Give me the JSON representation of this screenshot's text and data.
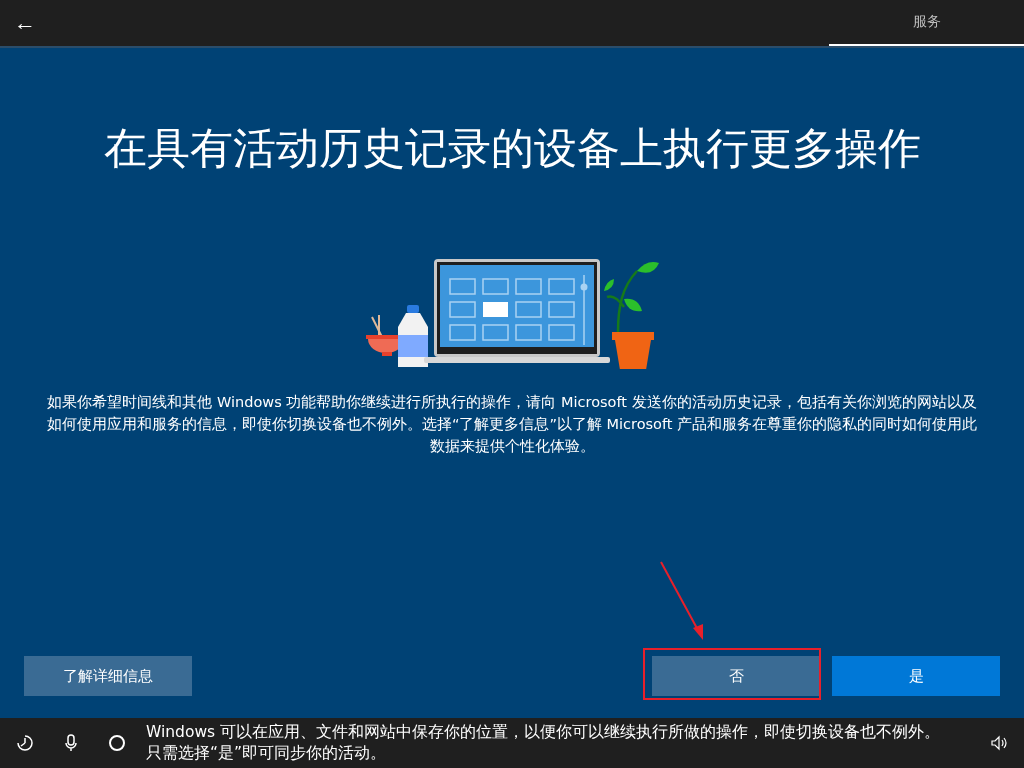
{
  "top_bar": {
    "back": "←",
    "tabs": [
      {
        "label": "服务",
        "selected": true
      }
    ]
  },
  "title": "在具有活动历史记录的设备上执行更多操作",
  "description": "如果你希望时间线和其他 Windows 功能帮助你继续进行所执行的操作，请向 Microsoft 发送你的活动历史记录，包括有关你浏览的网站以及如何使用应用和服务的信息，即使你切换设备也不例外。选择“了解更多信息”以了解 Microsoft 产品和服务在尊重你的隐私的同时如何使用此数据来提供个性化体验。",
  "buttons": [
    {
      "label": "了解详细信息",
      "kind": "secondary",
      "highlighted": false
    },
    {
      "label": "否",
      "kind": "secondary",
      "highlighted": true
    },
    {
      "label": "是",
      "kind": "primary",
      "highlighted": false
    }
  ],
  "bottom_bar": {
    "narration": "Windows 可以在应用、文件和网站中保存你的位置，以便你可以继续执行所做的操作，即使切换设备也不例外。只需选择“是”即可同步你的活动。"
  }
}
